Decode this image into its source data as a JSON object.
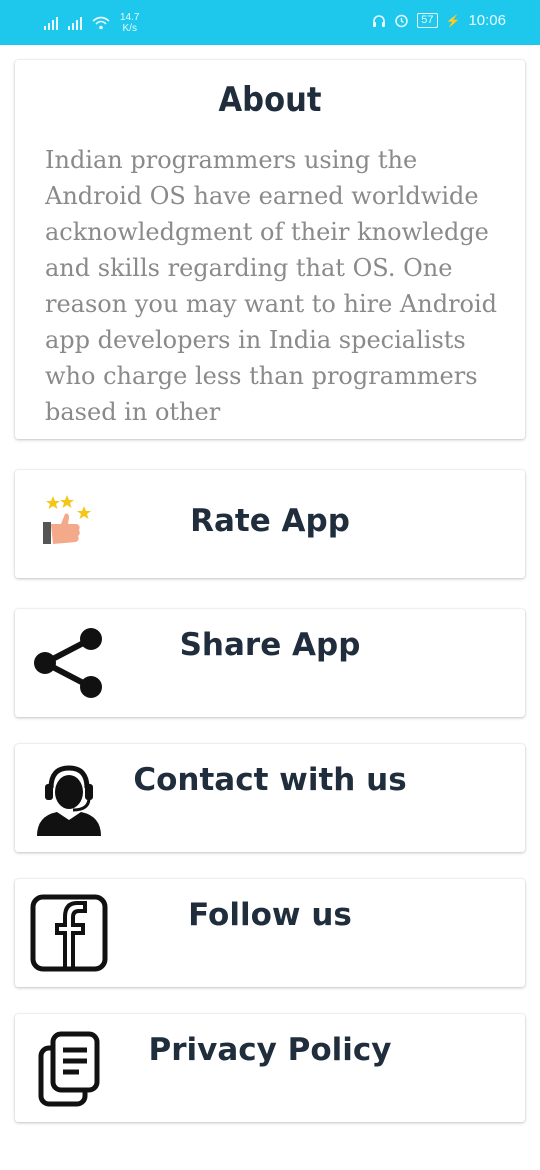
{
  "status_bar": {
    "speed_value": "14.7",
    "speed_unit": "K/s",
    "battery": "57",
    "time": "10:06"
  },
  "about": {
    "title": "About",
    "text": "Indian programmers using the Android OS have earned worldwide acknowledgment of their knowledge and skills regarding that OS. One reason you may want to hire Android app developers in India specialists who charge less than programmers based in other"
  },
  "menu": {
    "rate": {
      "label": "Rate App",
      "icon": "thumbs-up-stars-icon"
    },
    "share": {
      "label": "Share App",
      "icon": "share-icon"
    },
    "contact": {
      "label": "Contact with us",
      "icon": "headset-support-icon"
    },
    "follow": {
      "label": "Follow us",
      "icon": "facebook-icon"
    },
    "privacy": {
      "label": "Privacy Policy",
      "icon": "document-icon"
    }
  }
}
